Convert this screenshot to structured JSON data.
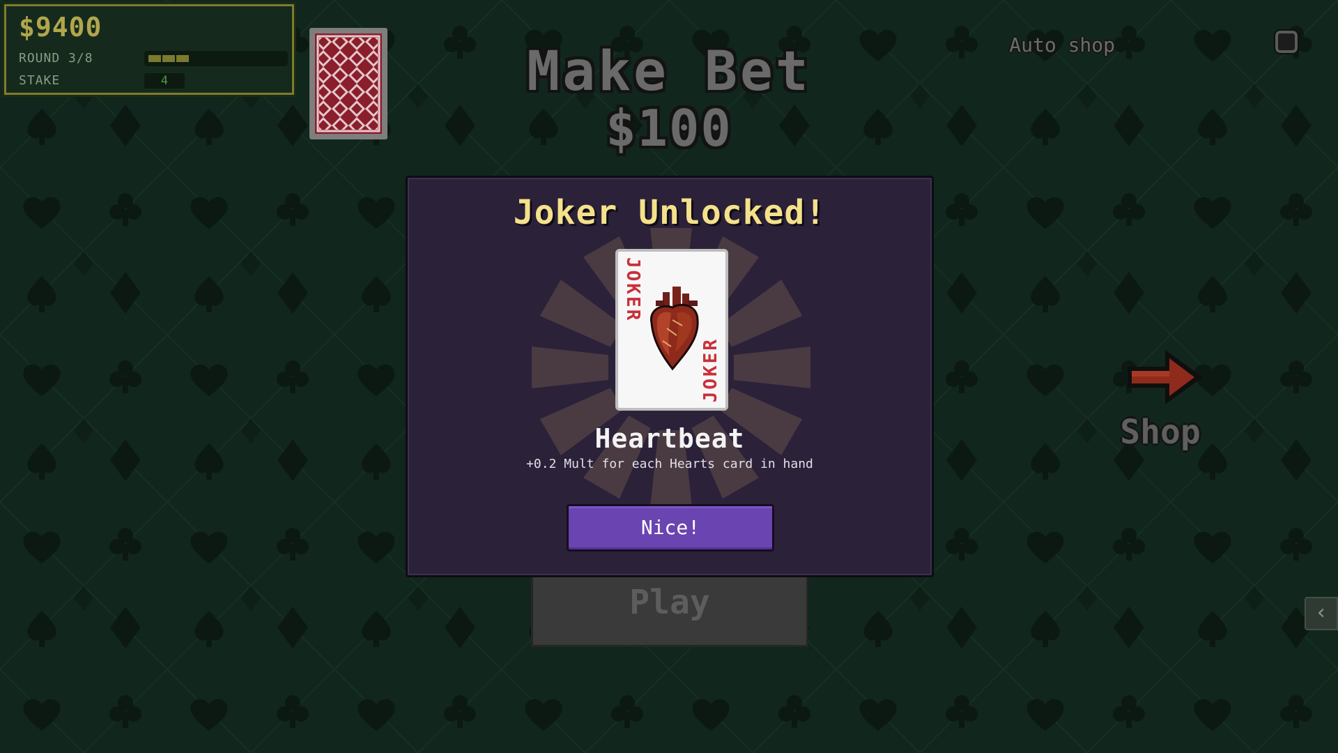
{
  "hud": {
    "money": "$9400",
    "round_label": "ROUND 3/8",
    "round_progress": 0.375,
    "stake_label": "STAKE",
    "stake_value": "4"
  },
  "header": {
    "title": "Make Bet",
    "bet_amount": "$100"
  },
  "auto_shop": {
    "label": "Auto shop",
    "checked": false
  },
  "shop": {
    "label": "Shop"
  },
  "play_button": {
    "label": "Play"
  },
  "modal": {
    "title": "Joker Unlocked!",
    "card_word": "JOKER",
    "joker_name": "Heartbeat",
    "joker_description": "+0.2 Mult for each Hearts card in hand",
    "confirm_label": "Nice!"
  },
  "colors": {
    "felt": "#12241c",
    "modal_bg": "#2b2139",
    "title_yellow": "#f4e18a",
    "button_purple": "#6a44b0",
    "card_red": "#c8303a",
    "shop_arrow": "#8e2b1c"
  },
  "icons": {
    "deck": "card-back-icon",
    "shop": "right-arrow-icon",
    "collapse": "chevron-left-icon"
  }
}
